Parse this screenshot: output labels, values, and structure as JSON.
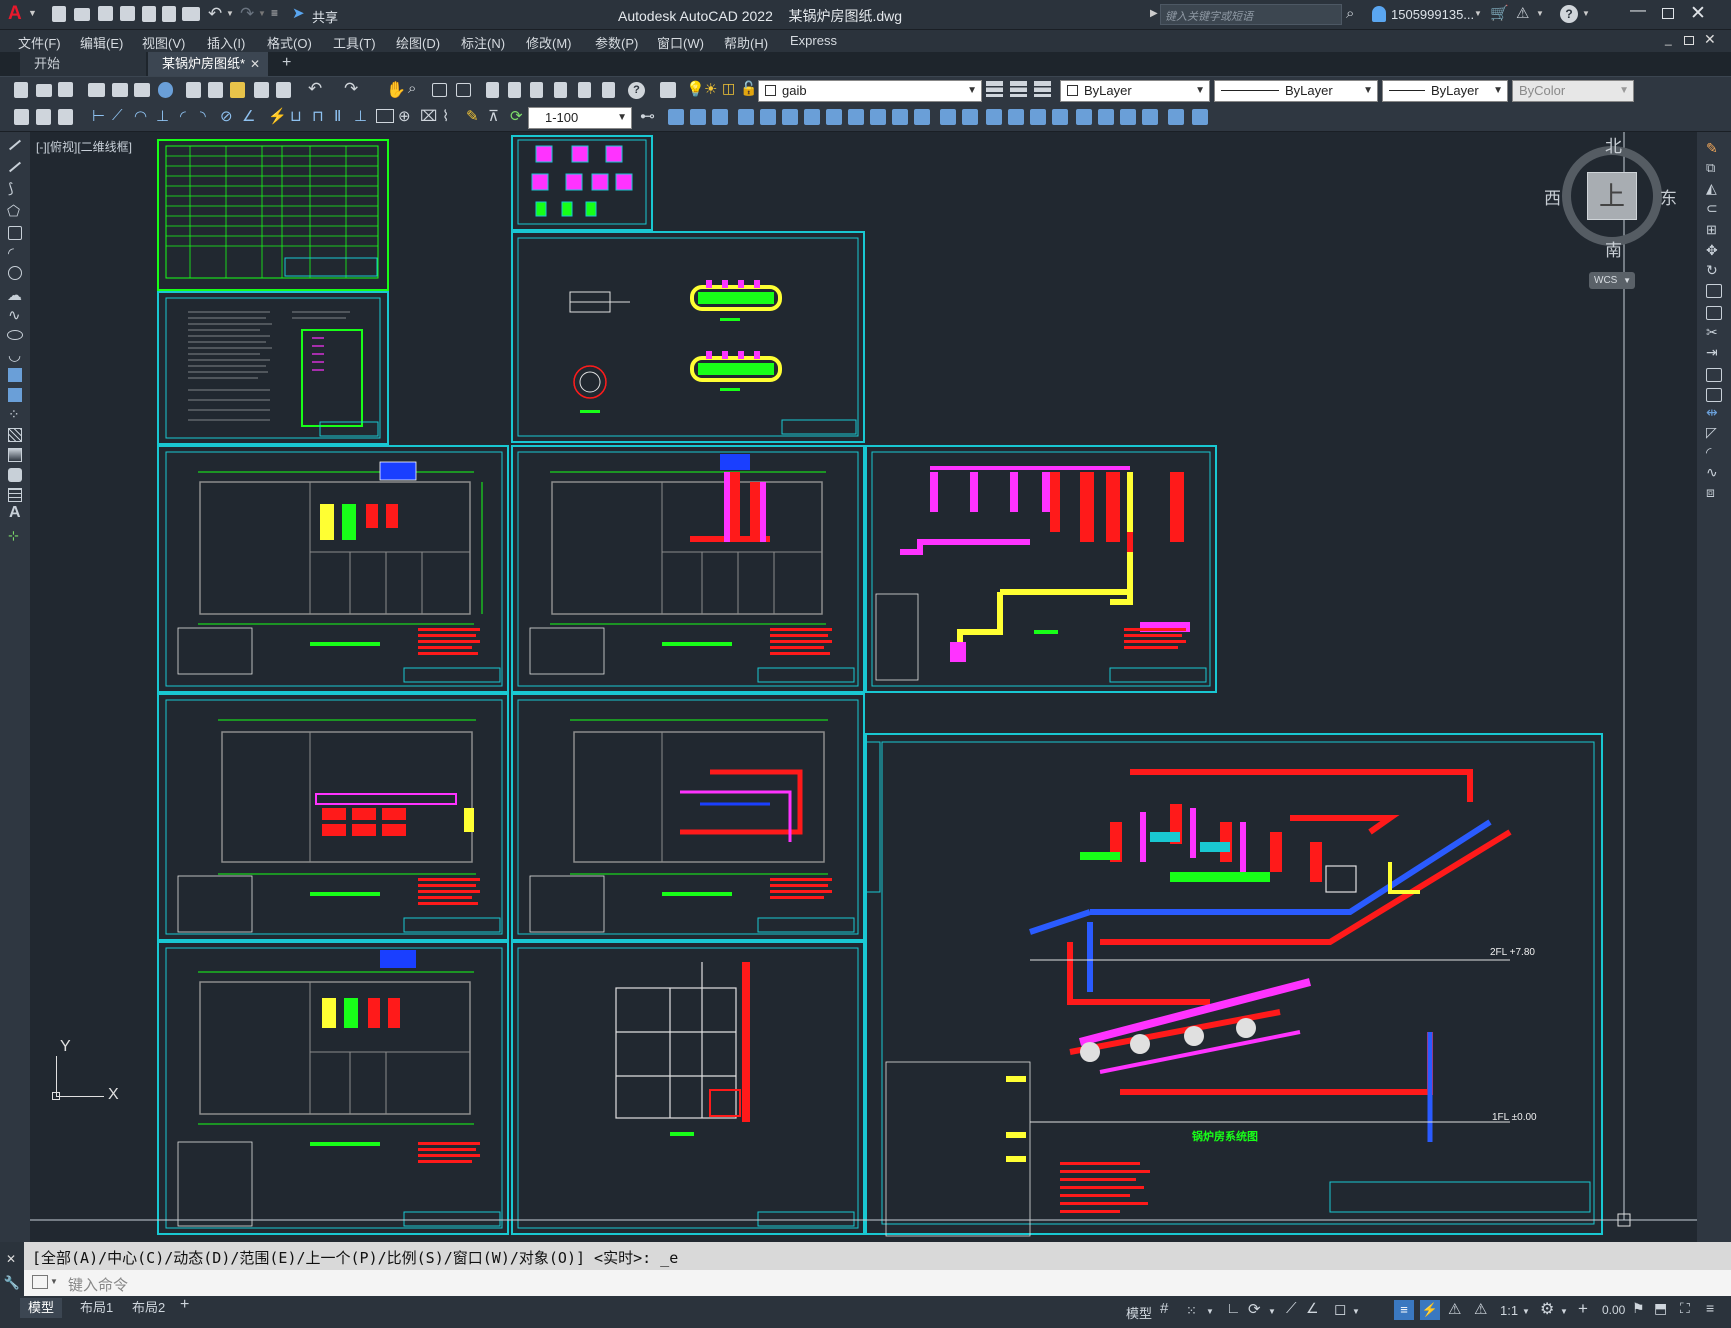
{
  "titlebar": {
    "app_logo": "A",
    "title": "Autodesk AutoCAD 2022    某锅炉房图纸.dwg",
    "share_label": "共享",
    "search_placeholder": "键入关键字或短语",
    "user": "1505999135...",
    "icons": [
      "new-icon",
      "open-icon",
      "save-icon",
      "saveas-icon",
      "plot-icon",
      "undo-icon",
      "redo-icon",
      "share-icon",
      "search-icon",
      "user-icon",
      "cart-icon",
      "help-icon",
      "minimize-icon",
      "maximize-icon",
      "close-icon"
    ]
  },
  "menu": [
    "文件(F)",
    "编辑(E)",
    "视图(V)",
    "插入(I)",
    "格式(O)",
    "工具(T)",
    "绘图(D)",
    "标注(N)",
    "修改(M)",
    "参数(P)",
    "窗口(W)",
    "帮助(H)",
    "Express"
  ],
  "tabs": [
    {
      "label": "开始",
      "active": false
    },
    {
      "label": "某锅炉房图纸*",
      "active": true
    }
  ],
  "toolbar": {
    "layer_name": "gaib",
    "color": "ByLayer",
    "linetype": "ByLayer",
    "lineweight": "ByLayer",
    "plotstyle": "ByColor",
    "scale": "1-100"
  },
  "viewport_label": "[-][俯视][二维线框]",
  "viewcube": {
    "north": "北",
    "south": "南",
    "east": "东",
    "west": "西",
    "face": "上",
    "wcs": "WCS"
  },
  "ucs": {
    "x": "X",
    "y": "Y"
  },
  "drawing_labels": {
    "level_2fl": "2FL +7.80",
    "level_1fl": "1FL ±0.00",
    "system_title": "锅炉房系统图"
  },
  "command": {
    "history": "[全部(A)/中心(C)/动态(D)/范围(E)/上一个(P)/比例(S)/窗口(W)/对象(O)] <实时>: _e",
    "placeholder": "键入命令"
  },
  "layout_tabs": [
    "模型",
    "布局1",
    "布局2"
  ],
  "status": {
    "model": "模型",
    "scale": "1:1"
  },
  "colors": {
    "sheet_border": "#19c8d2",
    "pipe_red": "#ff1a1a",
    "pipe_magenta": "#ff33ff",
    "pipe_blue": "#2a5bff",
    "pipe_yellow": "#ffff33",
    "green": "#18ff18"
  }
}
